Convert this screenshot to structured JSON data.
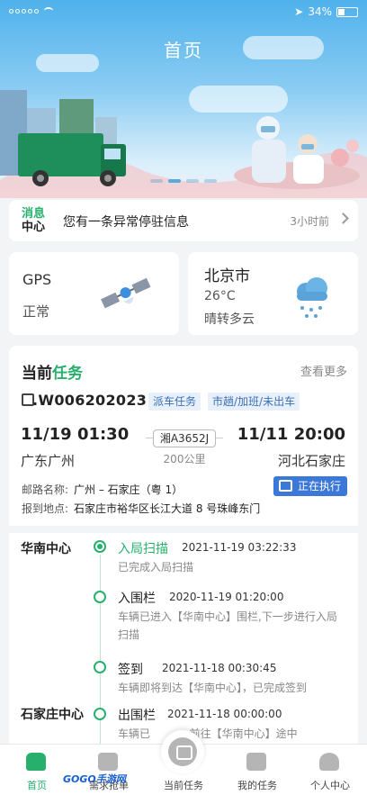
{
  "status_bar": {
    "battery": "34%"
  },
  "header": {
    "title": "首页"
  },
  "message": {
    "badge_top": "消息",
    "badge_bottom": "中心",
    "text": "您有一条异常停驻信息",
    "time": "3小时前"
  },
  "gps": {
    "label": "GPS",
    "status": "正常"
  },
  "weather": {
    "city": "北京市",
    "temperature": "26°C",
    "description": "晴转多云"
  },
  "task": {
    "title_prefix": "当前",
    "title_suffix": "任务",
    "more": "查看更多",
    "number": ".W006202023",
    "tags": [
      "派车任务",
      "市趟/加班/未出车"
    ],
    "departure_time": "11/19 01:30",
    "arrival_time": "11/11 20:00",
    "plate": "湘A3652J",
    "distance": "200公里",
    "departure_city": "广东广州",
    "arrival_city": "河北石家庄",
    "route_label": "邮路名称:",
    "route_value": "广州 – 石家庄（粤 1）",
    "address_label": "报到地点:",
    "address_value": "石家庄市裕华区长江大道 8 号珠峰东门",
    "status": "正在执行"
  },
  "timeline": {
    "centers": [
      "华南中心",
      "石家庄中心"
    ],
    "events": [
      {
        "title": "入局扫描",
        "time": "2021-11-19 03:22:33",
        "desc": "已完成入局扫描"
      },
      {
        "title": "入围栏",
        "time": "2020-11-19 01:20:00",
        "desc": "车辆已进入【华南中心】围栏,下一步进行入局扫描"
      },
      {
        "title": "签到",
        "time": "2021-11-18 00:30:45",
        "desc": "车辆即将到达【华南中心】，已完成签到"
      },
      {
        "title": "出围栏",
        "time": "2021-11-18 00:00:00",
        "desc": "车辆已 　　　 前往【华南中心】途中"
      }
    ]
  },
  "nav": {
    "items": [
      "首页",
      "需求抢单",
      "当前任务",
      "我的任务",
      "个人中心"
    ],
    "watermark": "GOGO手游网"
  },
  "colors": {
    "accent": "#26b06b",
    "sky": "#4fb1ec",
    "badge": "#3c78d8"
  }
}
